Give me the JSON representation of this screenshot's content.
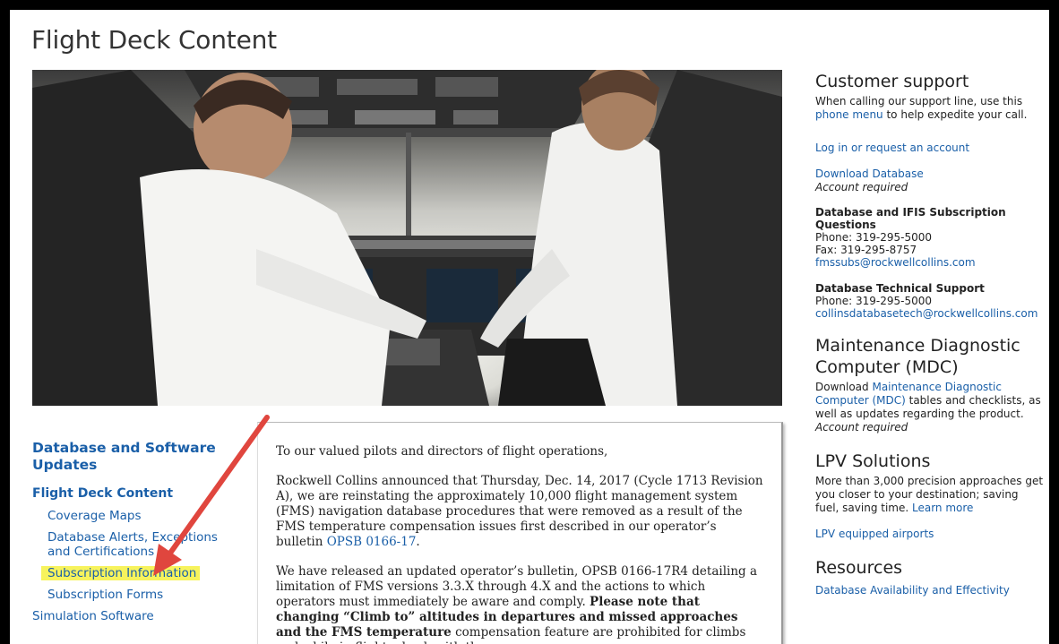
{
  "page": {
    "title": "Flight Deck Content"
  },
  "left_nav": {
    "heading": "Database and Software Updates",
    "section": "Flight Deck Content",
    "sub_items": [
      {
        "label": "Coverage Maps"
      },
      {
        "label": "Database Alerts, Exceptions and Certifications"
      },
      {
        "label": "Subscription Information"
      },
      {
        "label": "Subscription Forms"
      }
    ],
    "bottom_item": "Simulation Software"
  },
  "content": {
    "greeting": "To our valued pilots and directors of flight operations,",
    "p1_text": "Rockwell Collins announced that Thursday, Dec. 14, 2017 (Cycle 1713 Revision A), we are reinstating the approximately 10,000 flight management system (FMS) navigation database procedures that were removed as a result of the FMS temperature compensation issues first described in our operator’s bulletin ",
    "p1_link": "OPSB 0166-17",
    "p1_end": ".",
    "p2_text": "We have released an updated operator’s bulletin, OPSB 0166-17R4 detailing a limitation of FMS versions 3.3.X through 4.X and the actions to which operators must immediately be aware and comply. ",
    "p2_bold": "Please note that changing “Climb to” altitudes in departures and missed approaches and the FMS temperature",
    "p2_more": "compensation feature are prohibited for climbs and while in flight; check with the"
  },
  "sidebar": {
    "customer_support": {
      "title": "Customer support",
      "text_before": "When calling our support line, use this ",
      "link": "phone menu",
      "text_after": " to help expedite your call."
    },
    "login_link": "Log in or request an account",
    "download": {
      "link": "Download Database",
      "note": "Account required"
    },
    "subscription_questions": {
      "title": "Database and IFIS Subscription Questions",
      "phone": "Phone: 319-295-5000",
      "fax": "Fax: 319-295-8757",
      "email": "fmssubs@rockwellcollins.com"
    },
    "tech_support": {
      "title": "Database Technical Support",
      "phone": "Phone: 319-295-5000",
      "email": "collinsdatabasetech@rockwellcollins.com"
    },
    "mdc": {
      "title": "Maintenance Diagnostic Computer (MDC)",
      "text_before": "Download ",
      "link": "Maintenance Diagnostic Computer (MDC)",
      "text_after": " tables and checklists, as well as updates regarding the product. ",
      "note": "Account required"
    },
    "lpv": {
      "title": "LPV Solutions",
      "text": "More than 3,000 precision approaches get you closer to your destination; saving fuel, saving time. ",
      "link": "Learn more",
      "airports_link": "LPV equipped airports"
    },
    "resources": {
      "title": "Resources",
      "link": "Database Availability and Effectivity"
    }
  },
  "colors": {
    "link": "#1a5fa8",
    "highlight": "#f7f35c",
    "arrow": "#e0463e"
  },
  "icons": {
    "annotation": "red-arrow"
  }
}
